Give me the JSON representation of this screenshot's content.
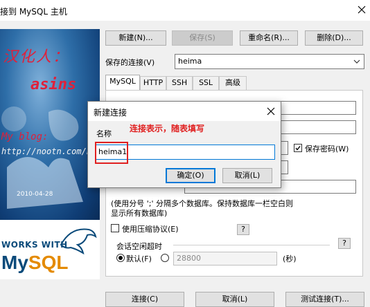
{
  "window": {
    "title": "接到 MySQL 主机"
  },
  "sidepanel": {
    "handwriting": "汉化人：",
    "author": "asins",
    "blog_label": "My blog:",
    "blog_url": "http://nootn.com/blog",
    "date": "2010-04-28",
    "works_with": "WORKS WITH",
    "mysql_my": "My",
    "mysql_sql": "SQL"
  },
  "toolbar": {
    "new_label": "新建(N)...",
    "save_label": "保存(S)",
    "rename_label": "重命名(R)...",
    "delete_label": "删除(D)..."
  },
  "saved_connection": {
    "label": "保存的连接(V)",
    "value": "heima"
  },
  "tabs": [
    {
      "label": "MySQL"
    },
    {
      "label": "HTTP"
    },
    {
      "label": "SSH"
    },
    {
      "label": "SSL"
    },
    {
      "label": "高级"
    }
  ],
  "form": {
    "save_password_label": "保存密码(W)",
    "db_hint_line1": "(使用分号 ';' 分隔多个数据库。保持数据库一栏空白则",
    "db_hint_line2": "显示所有数据库)",
    "compression_label": "使用压缩协议(E)",
    "help_q": "?",
    "session_timeout_label": "会话空闲超时",
    "default_label": "默认(F)",
    "timeout_value": "28800",
    "seconds_label": "(秒)"
  },
  "bottom_buttons": {
    "connect_label": "连接(C)",
    "cancel_label": "取消(L)",
    "test_label": "测试连接(T)..."
  },
  "dialog": {
    "title": "新建连接",
    "name_label": "名称",
    "annotation": "连接表示，随表填写",
    "name_value": "heima1",
    "ok_label": "确定(O)",
    "cancel_label": "取消(L)"
  }
}
